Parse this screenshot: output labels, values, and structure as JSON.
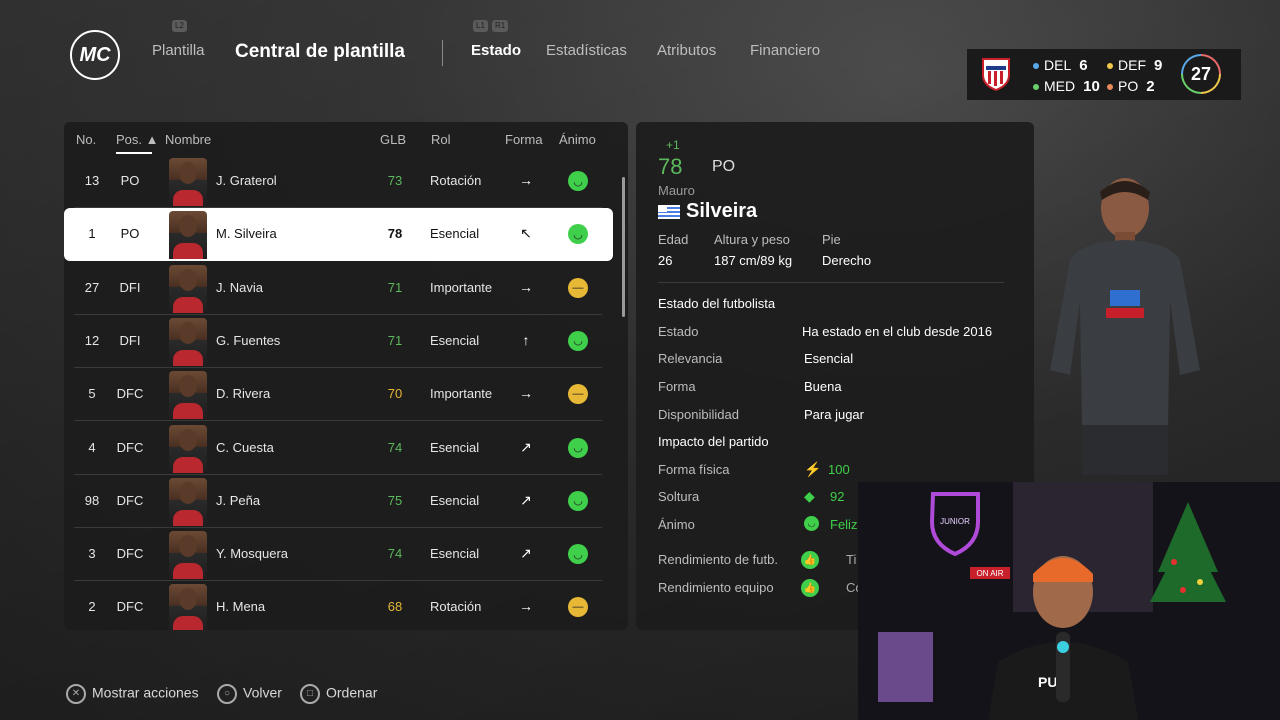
{
  "header": {
    "logo_text": "MC",
    "nav_plantilla": "Plantilla",
    "title": "Central de plantilla",
    "tabs": [
      "Estado",
      "Estadísticas",
      "Atributos",
      "Financiero"
    ],
    "hint_left": "L2",
    "hint_l1": "L1",
    "hint_r1": "R1"
  },
  "team_summary": {
    "del_label": "DEL",
    "del_count": "6",
    "def_label": "DEF",
    "def_count": "9",
    "med_label": "MED",
    "med_count": "10",
    "po_label": "PO",
    "po_count": "2",
    "overall": "27",
    "badge_text": "JUNIOR"
  },
  "list": {
    "columns": {
      "no": "No.",
      "pos": "Pos.",
      "nombre": "Nombre",
      "glb": "GLB",
      "rol": "Rol",
      "forma": "Forma",
      "animo": "Ánimo"
    },
    "rows": [
      {
        "no": "13",
        "pos": "PO",
        "name": "J. Graterol",
        "glb": "73",
        "rol": "Rotación",
        "forma": "→",
        "mood": "happy"
      },
      {
        "no": "1",
        "pos": "PO",
        "name": "M. Silveira",
        "glb": "78",
        "rol": "Esencial",
        "forma": "↖",
        "mood": "happy"
      },
      {
        "no": "27",
        "pos": "DFI",
        "name": "J. Navia",
        "glb": "71",
        "rol": "Importante",
        "forma": "→",
        "mood": "neutral"
      },
      {
        "no": "12",
        "pos": "DFI",
        "name": "G. Fuentes",
        "glb": "71",
        "rol": "Esencial",
        "forma": "↑",
        "mood": "happy"
      },
      {
        "no": "5",
        "pos": "DFC",
        "name": "D. Rivera",
        "glb": "70",
        "rol": "Importante",
        "forma": "→",
        "mood": "neutral"
      },
      {
        "no": "4",
        "pos": "DFC",
        "name": "C. Cuesta",
        "glb": "74",
        "rol": "Esencial",
        "forma": "↗",
        "mood": "happy"
      },
      {
        "no": "98",
        "pos": "DFC",
        "name": "J. Peña",
        "glb": "75",
        "rol": "Esencial",
        "forma": "↗",
        "mood": "happy"
      },
      {
        "no": "3",
        "pos": "DFC",
        "name": "Y. Mosquera",
        "glb": "74",
        "rol": "Esencial",
        "forma": "↗",
        "mood": "happy"
      },
      {
        "no": "2",
        "pos": "DFC",
        "name": "H. Mena",
        "glb": "68",
        "rol": "Rotación",
        "forma": "→",
        "mood": "neutral"
      }
    ]
  },
  "detail": {
    "ovr_delta": "+1",
    "ovr": "78",
    "pos": "PO",
    "first_name": "Mauro",
    "last_name": "Silveira",
    "edad_label": "Edad",
    "edad": "26",
    "altura_label": "Altura y peso",
    "altura": "187 cm/89 kg",
    "pie_label": "Pie",
    "pie": "Derecho",
    "section1": "Estado del futbolista",
    "estado_label": "Estado",
    "estado": "Ha estado en el club desde 2016",
    "relevancia_label": "Relevancia",
    "relevancia": "Esencial",
    "forma_label": "Forma",
    "forma": "Buena",
    "disp_label": "Disponibilidad",
    "disp": "Para jugar",
    "section2": "Impacto del partido",
    "fisica_label": "Forma física",
    "fisica": "100",
    "soltura_label": "Soltura",
    "soltura": "92",
    "animo_label": "Ánimo",
    "animo": "Feliz",
    "rend_futb_label": "Rendimiento de futb.",
    "rend_futb": "Ti",
    "rend_equipo_label": "Rendimiento equipo",
    "rend_equipo": "Co"
  },
  "footer": {
    "acciones": "Mostrar acciones",
    "volver": "Volver",
    "ordenar": "Ordenar"
  },
  "webcam": {
    "sign_text": "ON AIR",
    "shirt_text": "PU"
  },
  "colors": {
    "green": "#3fcf4a",
    "yellow": "#e6b836",
    "glb_green": "#5cb85c",
    "glb_yellow": "#e6b836"
  }
}
